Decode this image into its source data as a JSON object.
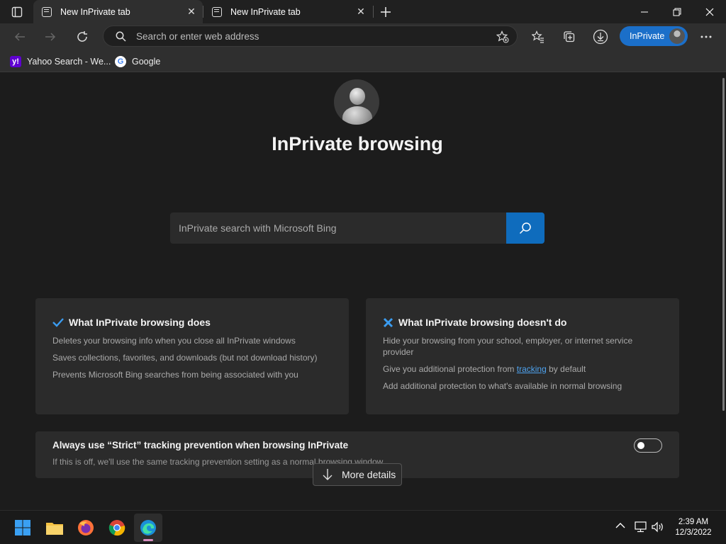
{
  "tabs": [
    {
      "title": "New InPrivate tab",
      "active": true
    },
    {
      "title": "New InPrivate tab",
      "active": false
    }
  ],
  "window": {
    "minimize": "—",
    "restore": "❐",
    "close": "✕"
  },
  "address": {
    "placeholder": "Search or enter web address",
    "value": ""
  },
  "inprivate_pill": {
    "label": "InPrivate"
  },
  "favorites": [
    {
      "label": "Yahoo Search - We...",
      "icon": "yahoo-icon"
    },
    {
      "label": "Google",
      "icon": "google-icon"
    }
  ],
  "hero": {
    "title": "InPrivate browsing"
  },
  "bing": {
    "placeholder": "InPrivate search with Microsoft Bing"
  },
  "card_does": {
    "title": "What InPrivate browsing does",
    "lines": [
      "Deletes your browsing info when you close all InPrivate windows",
      "Saves collections, favorites, and downloads (but not download history)",
      "Prevents Microsoft Bing searches from being associated with you"
    ]
  },
  "card_doesnt": {
    "title": "What InPrivate browsing doesn't do",
    "line1a": "Hide your browsing from your school, employer, or internet service",
    "line1b": "provider",
    "line2_pre": "Give you additional protection from ",
    "line2_link": "tracking",
    "line2_post": " by default",
    "line3": "Add additional protection to what's available in normal browsing"
  },
  "strict": {
    "title": "Always use “Strict” tracking prevention when browsing InPrivate",
    "desc": "If this is off, we'll use the same tracking prevention setting as a normal browsing window",
    "enabled": false
  },
  "more_details": {
    "label": "More details"
  },
  "clock": {
    "time": "2:39 AM",
    "date": "12/3/2022"
  },
  "colors": {
    "accent": "#0f6cbd",
    "pill": "#1b6fc9",
    "link": "#4ea3f0"
  }
}
